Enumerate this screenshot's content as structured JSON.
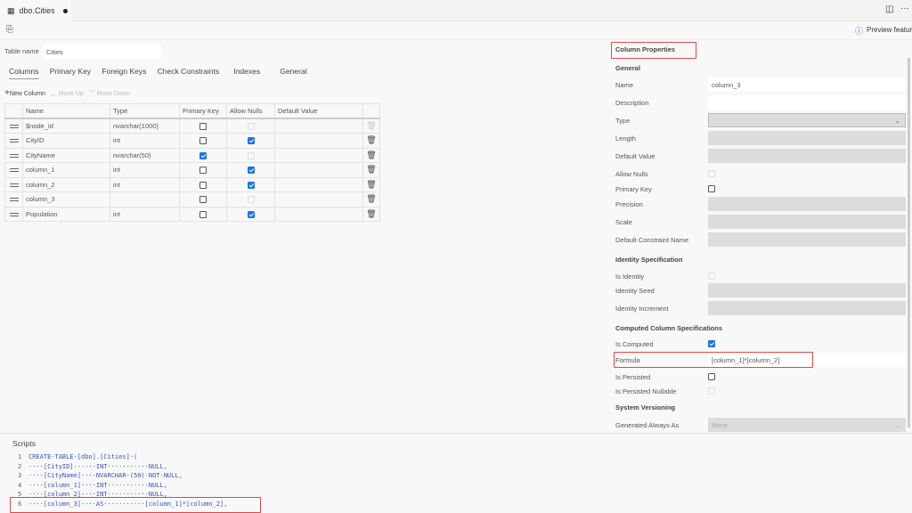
{
  "tab": {
    "title": "dbo.Cities"
  },
  "header": {
    "preview": "Preview feature"
  },
  "table_name": {
    "label": "Table name",
    "value": "Cities"
  },
  "tabs": [
    "Columns",
    "Primary Key",
    "Foreign Keys",
    "Check Constraints",
    "Indexes",
    "General"
  ],
  "actions": {
    "new_column": "New Column",
    "move_up": "Move Up",
    "move_down": "Move Down"
  },
  "grid": {
    "headers": [
      "Name",
      "Type",
      "Primary Key",
      "Allow Nulls",
      "Default Value"
    ],
    "rows": [
      {
        "name": "$node_id",
        "type": "nvarchar(1000)",
        "pk": false,
        "nulls": null,
        "del_disabled": true
      },
      {
        "name": "CityID",
        "type": "int",
        "pk": false,
        "nulls": true
      },
      {
        "name": "CityName",
        "type": "nvarchar(50)",
        "pk": true,
        "nulls": null
      },
      {
        "name": "column_1",
        "type": "int",
        "pk": false,
        "nulls": true
      },
      {
        "name": "column_2",
        "type": "int",
        "pk": false,
        "nulls": true
      },
      {
        "name": "column_3",
        "type": "",
        "pk": false,
        "nulls": null
      },
      {
        "name": "Population",
        "type": "int",
        "pk": false,
        "nulls": true
      }
    ]
  },
  "props": {
    "title": "Column Properties",
    "general": "General",
    "name_label": "Name",
    "name_value": "column_3",
    "description_label": "Description",
    "type_label": "Type",
    "length_label": "Length",
    "default_label": "Default Value",
    "allow_nulls_label": "Allow Nulls",
    "primary_key_label": "Primary Key",
    "precision_label": "Precision",
    "scale_label": "Scale",
    "constraint_label": "Default Constraint Name",
    "identity": "Identity Specification",
    "is_identity_label": "Is Identity",
    "seed_label": "Identity Seed",
    "increment_label": "Identity Increment",
    "computed": "Computed Column Specifications",
    "is_computed_label": "Is Computed",
    "formula_label": "Formula",
    "formula_value": "[column_1]*[column_2]",
    "persisted_label": "Is Persisted",
    "persisted_nullable_label": "Is Persisted Nullable",
    "versioning": "System Versioning",
    "generated_label": "Generated Always As",
    "generated_value": "None"
  },
  "scripts": {
    "title": "Scripts",
    "lines": [
      "CREATE·TABLE·[dbo].[Cities]·(",
      "····[CityID]······INT···········NULL,",
      "····[CityName]····NVARCHAR·(50)·NOT·NULL,",
      "····[column_1]····INT···········NULL,",
      "····[column_2]····INT···········NULL,",
      "····[column_3]····AS···········[column_1]*[column_2],"
    ]
  }
}
